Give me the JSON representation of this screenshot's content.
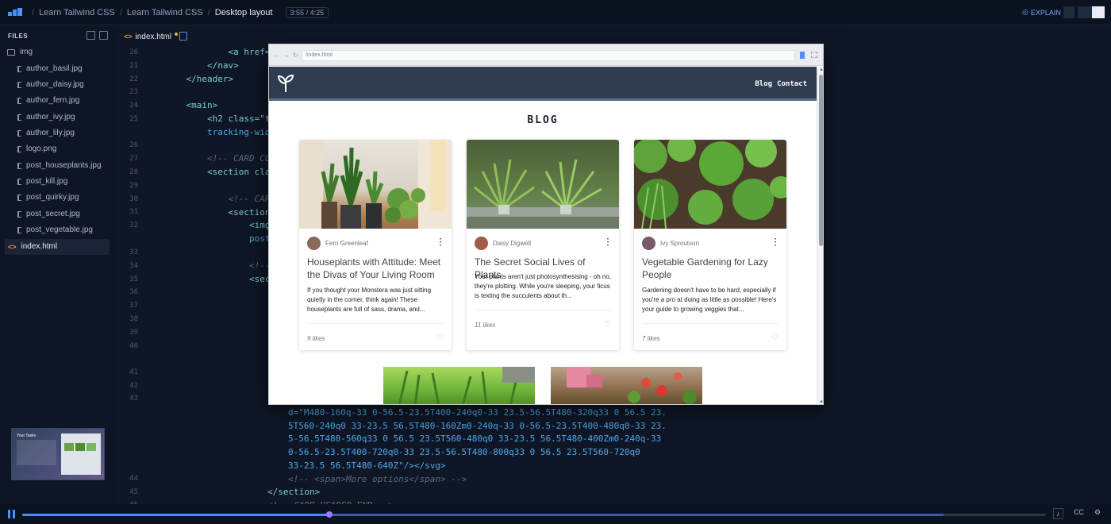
{
  "breadcrumb": {
    "items": [
      "Learn Tailwind CSS",
      "Learn Tailwind CSS",
      "Desktop layout"
    ],
    "time": "3:55 / 4:25"
  },
  "topbar": {
    "explain_label": "EXPLAIN"
  },
  "sidebar": {
    "title": "FILES",
    "folder": "img",
    "files": [
      "author_basil.jpg",
      "author_daisy.jpg",
      "author_fern.jpg",
      "author_ivy.jpg",
      "author_lily.jpg",
      "logo.png",
      "post_houseplants.jpg",
      "post_kill.jpg",
      "post_quirky.jpg",
      "post_secret.jpg",
      "post_vegetable.jpg"
    ],
    "selected_file": "index.html",
    "thumbnail_title": "Your Tasks"
  },
  "editor": {
    "tab_label": "index.html",
    "line_numbers": [
      "26",
      "21",
      "22",
      "23",
      "24",
      "25",
      "",
      "26",
      "27",
      "28",
      "29",
      "30",
      "31",
      "32",
      "",
      "33",
      "34",
      "35",
      "36",
      "37",
      "38",
      "39",
      "40",
      "",
      "41",
      "42",
      "43",
      "",
      "",
      "",
      "",
      "",
      "44",
      "45",
      "46"
    ],
    "code_lines": [
      {
        "indent": "            ",
        "tag": "<a href=",
        "rest": ""
      },
      {
        "indent": "        ",
        "tag": "</nav>",
        "rest": ""
      },
      {
        "indent": "    ",
        "tag": "</header>",
        "rest": ""
      },
      {
        "indent": "",
        "tag": "",
        "rest": ""
      },
      {
        "indent": "    ",
        "tag": "<main>",
        "rest": ""
      },
      {
        "indent": "        ",
        "tag": "<h2 class=\"t",
        "rest": ""
      },
      {
        "indent": "        ",
        "tag": "",
        "rest": "tracking-wid"
      },
      {
        "indent": "",
        "tag": "",
        "rest": ""
      },
      {
        "indent": "        ",
        "comment": "<!-- CARD CO"
      },
      {
        "indent": "        ",
        "tag": "<section cla",
        "rest": ""
      },
      {
        "indent": "",
        "tag": "",
        "rest": ""
      },
      {
        "indent": "            ",
        "comment": "<!-- CAR"
      },
      {
        "indent": "            ",
        "tag": "<section",
        "rest": ""
      },
      {
        "indent": "                ",
        "tag": "<img",
        "rest": ""
      },
      {
        "indent": "                ",
        "tag": "",
        "rest": "post"
      },
      {
        "indent": "",
        "tag": "",
        "rest": ""
      },
      {
        "indent": "                ",
        "comment": "<!--"
      },
      {
        "indent": "                ",
        "tag": "<sec",
        "rest": ""
      }
    ],
    "svg_path_lines": [
      "d=\"M480-160q-33 0-56.5-23.5T400-240q0-33 23.5-56.5T480-320q33 0 56.5 23.",
      "5T560-240q0 33-23.5 56.5T480-160Zm0-240q-33 0-56.5-23.5T400-480q0-33 23.",
      "5-56.5T480-560q33 0 56.5 23.5T560-480q0 33-23.5 56.5T480-400Zm0-240q-33",
      "0-56.5-23.5T400-720q0-33 23.5-56.5T480-800q33 0 56.5 23.5T560-720q0",
      "33-23.5 56.5T480-640Z\"/></svg>"
    ],
    "comment_more": "<!-- <span>More options</span> -->",
    "section_close": "</section>",
    "card_header_end": "<!-- CARD HEADER END -->"
  },
  "preview": {
    "url": "/index.html",
    "nav_links": [
      "Blog",
      "Contact"
    ],
    "blog_title": "BLOG",
    "cards": [
      {
        "author": "Fern Greenleaf",
        "title": "Houseplants with Attitude: Meet the Divas of Your Living Room",
        "excerpt": "If you thought your Monstera was just sitting quietly in the corner, think again! These houseplants are full of sass, drama, and...",
        "likes": "9 likes",
        "avatar_color": "#8a6a5a"
      },
      {
        "author": "Daisy Digwell",
        "title": "The Secret Social Lives of Plants",
        "excerpt": "Your plants aren't just photosynthesising - oh no, they're plotting. While you're sleeping, your ficus is texting the succulents about th...",
        "likes": "11 likes",
        "avatar_color": "#a35a4a"
      },
      {
        "author": "Ivy Sproutson",
        "title": "Vegetable Gardening for Lazy People",
        "excerpt": "Gardening doesn't have to be hard, especially if you're a pro at doing as little as possible! Here's your guide to growing veggies that...",
        "likes": "7 likes",
        "avatar_color": "#7a5a6a"
      }
    ]
  },
  "player": {
    "progress": 0.3,
    "buffered": 0.9,
    "cc_label": "CC"
  },
  "colors": {
    "accent": "#4d8fff",
    "nav_bg": "#2f3c52"
  }
}
